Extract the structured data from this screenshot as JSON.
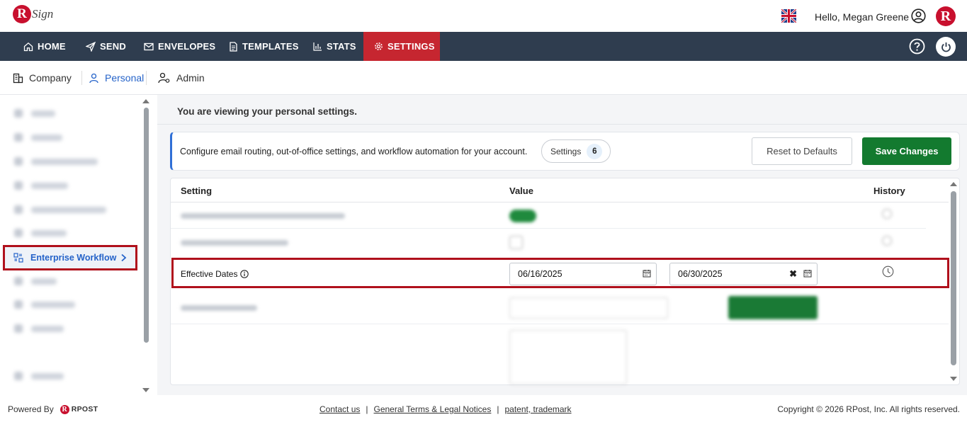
{
  "header": {
    "logo_text": "Sign",
    "greeting": "Hello, Megan Greene"
  },
  "nav": {
    "items": [
      {
        "label": "HOME",
        "icon": "home-icon"
      },
      {
        "label": "SEND",
        "icon": "send-icon"
      },
      {
        "label": "ENVELOPES",
        "icon": "envelope-icon"
      },
      {
        "label": "TEMPLATES",
        "icon": "document-icon"
      },
      {
        "label": "STATS",
        "icon": "bar-chart-icon"
      },
      {
        "label": "SETTINGS",
        "icon": "gear-icon",
        "active": true
      }
    ]
  },
  "subtabs": {
    "company": "Company",
    "personal": "Personal",
    "admin": "Admin"
  },
  "sidebar": {
    "active_item": "Enterprise Workflow"
  },
  "main": {
    "viewing_text": "You are viewing your personal settings.",
    "info_text": "Configure email routing, out-of-office settings, and workflow automation for your account.",
    "settings_pill_label": "Settings",
    "settings_count": "6",
    "reset_button": "Reset to Defaults",
    "save_button": "Save Changes"
  },
  "table": {
    "columns": [
      "Setting",
      "Value",
      "History"
    ],
    "effective_dates": {
      "label": "Effective Dates",
      "start": "06/16/2025",
      "end": "06/30/2025"
    }
  },
  "footer": {
    "powered_by": "Powered By",
    "rpost": "RPOST",
    "links": [
      "Contact us",
      "General Terms & Legal Notices",
      "patent, trademark"
    ],
    "copyright": "Copyright © 2026 RPost, Inc. All rights reserved."
  },
  "colors": {
    "nav_bg": "#2f3d4f",
    "active_nav": "#c62630",
    "brand_red": "#c8102e",
    "primary_blue": "#2563c9",
    "save_green": "#137a2f",
    "highlight_border": "#b0101c"
  }
}
